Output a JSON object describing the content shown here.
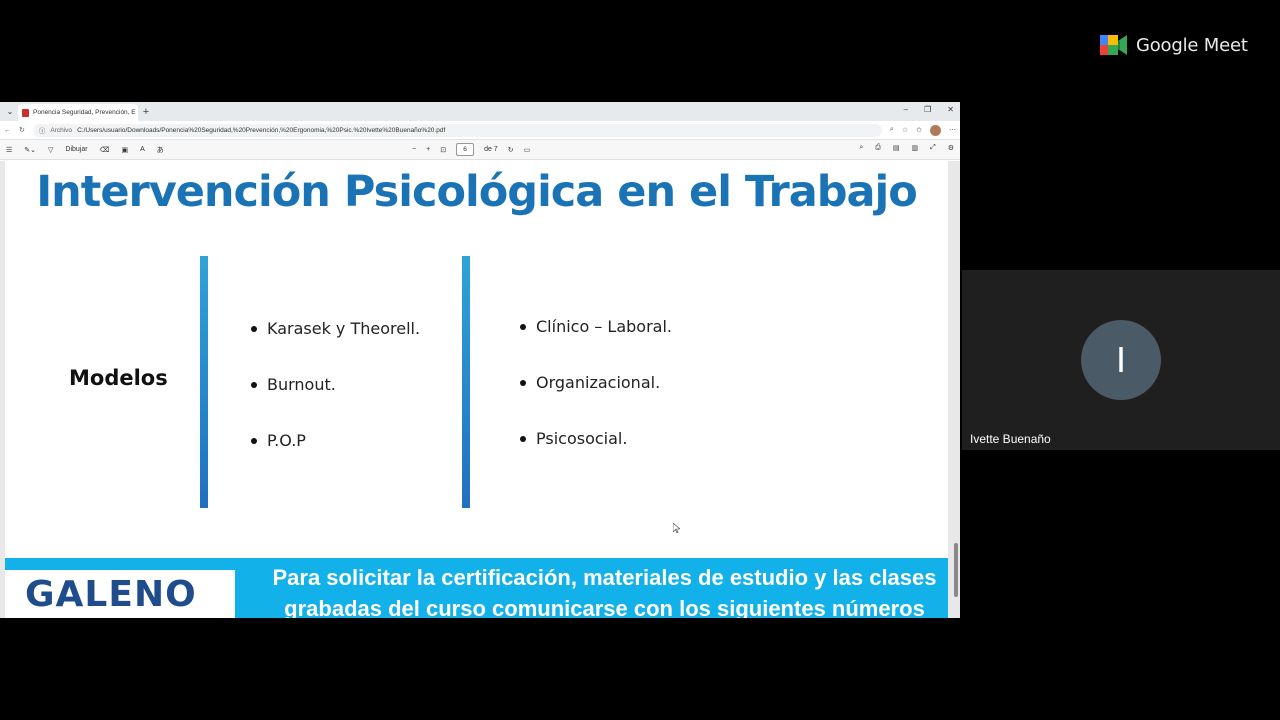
{
  "meet": {
    "brand": "Google Meet",
    "participant_initial": "I",
    "participant_name": "Ivette Buenaño"
  },
  "browser": {
    "tab_title": "Ponencia Seguridad, Prevención, E",
    "address_label": "Archivo",
    "url": "C:/Users/usuario/Downloads/Ponencia%20Seguridad,%20Prevención,%20Ergonomia,%20Psic.%20Ivette%20Buenaño%20.pdf"
  },
  "pdf_toolbar": {
    "draw_label": "Dibujar",
    "page_current": "6",
    "page_total": "de 7"
  },
  "slide": {
    "title": "Intervención Psicológica en el Trabajo",
    "section_label": "Modelos",
    "models": [
      "Karasek y Theorell.",
      "Burnout.",
      "P.O.P"
    ],
    "areas": [
      "Clínico – Laboral.",
      "Organizacional.",
      "Psicosocial."
    ]
  },
  "banner": {
    "logo_text": "GALENO´S",
    "message": "Para solicitar la certificación, materiales de estudio y las clases grabadas del curso comunicarse con los siguientes números"
  },
  "colors": {
    "title": "#1a73b5",
    "banner": "#13b1ea",
    "accent_bar": "#2a8fd0"
  }
}
